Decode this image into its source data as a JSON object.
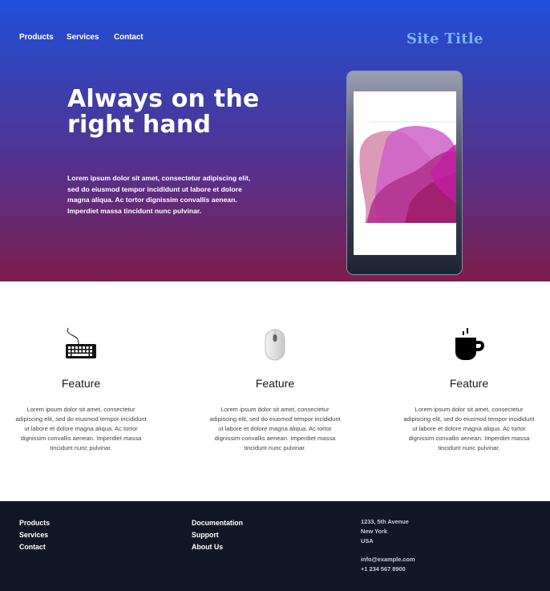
{
  "header": {
    "nav": [
      "Products",
      "Services",
      "Contact"
    ],
    "site_title": "Site Title"
  },
  "hero": {
    "heading": "Always on the right hand",
    "text": "Lorem ipsum dolor sit amet, consectetur adipiscing elit, sed do eiusmod tempor incididunt ut labore et dolore magna aliqua. Ac tortor dignissim convallis aenean. Imperdiet massa tincidunt nunc pulvinar."
  },
  "features": [
    {
      "icon": "keyboard-icon",
      "title": "Feature",
      "text": "Lorem ipsum dolor sit amet, consectetur adipiscing elit, sed do eiusmod tempor incididunt ut labore et dolore magna aliqua. Ac tortor dignissim convallis aenean. Imperdiet massa tincidunt nunc pulvinar."
    },
    {
      "icon": "mouse-icon",
      "title": "Feature",
      "text": "Lorem ipsum dolor sit amet, consectetur adipiscing elit, sed do eiusmod tempor incididunt ut labore et dolore magna aliqua. Ac tortor dignissim convallis aenean. Imperdiet massa tincidunt nunc pulvinar."
    },
    {
      "icon": "coffee-cup-icon",
      "title": "Feature",
      "text": "Lorem ipsum dolor sit amet, consectetur adipiscing elit, sed do eiusmod tempor incididunt ut labore et dolore magna aliqua. Ac tortor dignissim convallis aenean. Imperdiet massa tincidunt nunc pulvinar."
    }
  ],
  "footer": {
    "col1": [
      "Products",
      "Services",
      "Contact"
    ],
    "col2": [
      "Documentation",
      "Support",
      "About Us"
    ],
    "address": [
      "1233, 5th Avenue",
      "New York",
      "USA"
    ],
    "email": "info@example.com",
    "phone": "+1 234 567 8900"
  },
  "colors": {
    "hero_top": "#1f4fd9",
    "hero_bottom": "#7e1d4a",
    "site_title": "#7fb2f5",
    "footer_bg": "#121727"
  }
}
